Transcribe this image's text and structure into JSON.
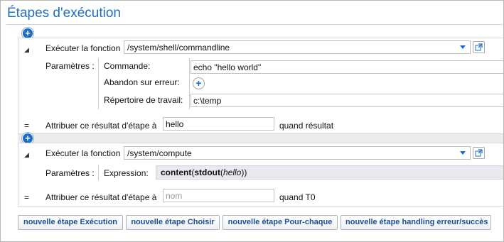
{
  "title": "Étapes d'exécution",
  "steps": [
    {
      "exec_label": "Exécuter la fonction",
      "function": "/system/shell/commandline",
      "params_label": "Paramètres :",
      "params": [
        {
          "label": "Commande:",
          "value": "echo \"hello world\""
        },
        {
          "label": "Abandon sur erreur:",
          "value": ""
        },
        {
          "label": "Répertoire de travail:",
          "value": "c:\\temp"
        }
      ],
      "assign_symbol": "=",
      "assign_label": "Attribuer ce résultat d'étape à",
      "result_value": "hello",
      "result_placeholder": "",
      "when_label": "quand résultat"
    },
    {
      "exec_label": "Exécuter la fonction",
      "function": "/system/compute",
      "params_label": "Paramètres :",
      "expression_label": "Expression:",
      "expression": {
        "fn1": "content",
        "p1": "(",
        "fn2": "stdout",
        "p2": "(",
        "arg": "hello",
        "p3": "))"
      },
      "assign_symbol": "=",
      "assign_label": "Attribuer ce résultat d'étape à",
      "result_value": "",
      "result_placeholder": "nom",
      "when_label": "quand T0"
    }
  ],
  "buttons": [
    "nouvelle étape Exécution",
    "nouvelle étape Choisir",
    "nouvelle étape Pour-chaque",
    "nouvelle étape handling erreur/succès"
  ],
  "icons": {
    "add": "plus-icon",
    "collapse": "triangle-collapse-icon",
    "open": "external-link-icon",
    "dropdown": "chevron-down-icon"
  },
  "colors": {
    "accent": "#1c6bc9",
    "title": "#1f6fbf",
    "button_text": "#1d4f8f"
  }
}
